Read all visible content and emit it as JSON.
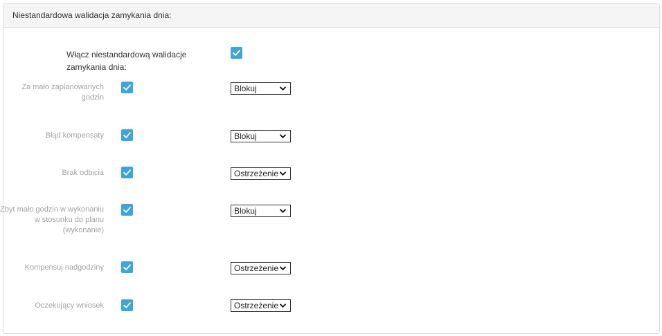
{
  "panel": {
    "title": "Niestandardowa walidacja zamykania dnia:"
  },
  "main_toggle": {
    "label": "Włącz niestandardową walidacje zamykania dnia:",
    "checked": true
  },
  "rows": [
    {
      "label": "Za mało zaplanowanych godzin",
      "checked": true,
      "action": "Blokuj"
    },
    {
      "label": "Błąd kompensaty",
      "checked": true,
      "action": "Blokuj"
    },
    {
      "label": "Brak odbicia",
      "checked": true,
      "action": "Ostrzeżenie"
    },
    {
      "label": "Zbyt mało godzin w wykonaniu w stosunku do planu (wykonanie)",
      "checked": true,
      "action": "Blokuj"
    },
    {
      "label": "Kompensuj nadgodziny",
      "checked": true,
      "action": "Ostrzeżenie"
    },
    {
      "label": "Oczekujący wniosek",
      "checked": true,
      "action": "Ostrzeżenie"
    }
  ],
  "colors": {
    "checkbox": "#3aa6dc",
    "header_bg": "#f5f5f5",
    "muted_label": "#a3a3a3"
  },
  "icons": {
    "checkbox": "checkmark-icon",
    "select": "chevron-down-icon"
  }
}
